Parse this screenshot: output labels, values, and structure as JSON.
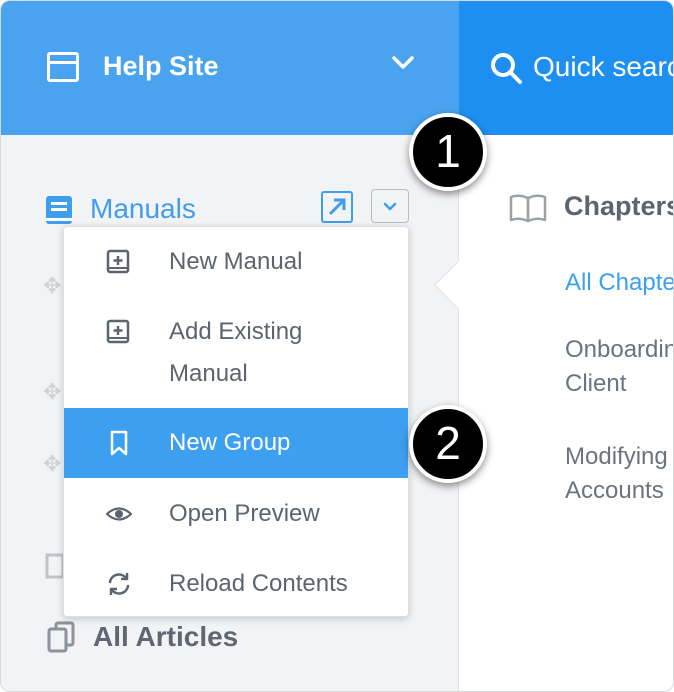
{
  "sidebar": {
    "site_title": "Help Site",
    "nav": {
      "manuals_label": "Manuals",
      "all_articles_label": "All Articles"
    }
  },
  "search": {
    "placeholder": "Quick search"
  },
  "main": {
    "chapter_title": "Chapters",
    "all_chapters_link": "All Chapters",
    "items": [
      {
        "line1": "Onboarding",
        "line2": "Client"
      },
      {
        "line1": "Modifying",
        "line2": "Accounts"
      }
    ]
  },
  "menu": {
    "items": [
      {
        "label": "New Manual",
        "icon": "add-book-icon"
      },
      {
        "label_line1": "Add Existing",
        "label_line2": "Manual",
        "icon": "add-book-icon"
      },
      {
        "label": "New Group",
        "icon": "bookmark-icon",
        "active": true
      },
      {
        "label": "Open Preview",
        "icon": "eye-icon"
      },
      {
        "label": "Reload Contents",
        "icon": "reload-icon"
      }
    ]
  },
  "callouts": [
    "1",
    "2"
  ],
  "colors": {
    "header_blue": "#4aa3ee",
    "search_blue": "#1d8ff0",
    "accent": "#3d9ff0",
    "callout_bg": "#000000"
  }
}
